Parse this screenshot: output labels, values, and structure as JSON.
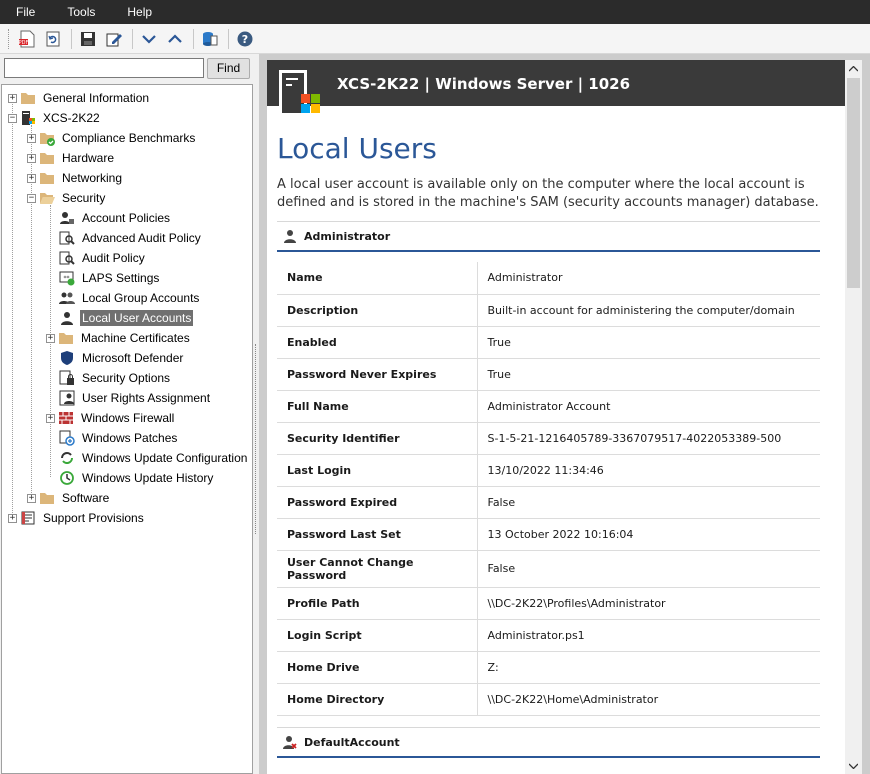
{
  "menu": {
    "file": "File",
    "tools": "Tools",
    "help": "Help"
  },
  "toolbar": {
    "icons": [
      "pdf-export-icon",
      "refresh-icon",
      "save-icon",
      "edit-icon",
      "collapse-down-icon",
      "expand-up-icon",
      "database-icon",
      "help-icon"
    ]
  },
  "search": {
    "value": "",
    "placeholder": "",
    "find_label": "Find"
  },
  "tree": {
    "general_information": "General Information",
    "server": "XCS-2K22",
    "compliance": "Compliance Benchmarks",
    "hardware": "Hardware",
    "networking": "Networking",
    "security": "Security",
    "account_policies": "Account Policies",
    "advanced_audit": "Advanced Audit Policy",
    "audit_policy": "Audit Policy",
    "laps": "LAPS Settings",
    "local_group": "Local Group Accounts",
    "local_user": "Local User Accounts",
    "machine_certs": "Machine Certificates",
    "defender": "Microsoft Defender",
    "security_options": "Security Options",
    "user_rights": "User Rights Assignment",
    "firewall": "Windows Firewall",
    "patches": "Windows Patches",
    "update_config": "Windows Update Configuration",
    "update_history": "Windows Update History",
    "software": "Software",
    "support": "Support Provisions"
  },
  "doc": {
    "header_title": "XCS-2K22 | Windows Server | 1026",
    "heading": "Local Users",
    "intro": "A local user account is available only on the computer where the local account is defined and is stored in the machine's SAM (security accounts manager) database.",
    "section1": "Administrator",
    "section2": "DefaultAccount",
    "rows": [
      {
        "k": "Name",
        "v": "Administrator"
      },
      {
        "k": "Description",
        "v": "Built-in account for administering the computer/domain"
      },
      {
        "k": "Enabled",
        "v": "True"
      },
      {
        "k": "Password Never Expires",
        "v": "True"
      },
      {
        "k": "Full Name",
        "v": "Administrator Account"
      },
      {
        "k": "Security Identifier",
        "v": "S-1-5-21-1216405789-3367079517-4022053389-500"
      },
      {
        "k": "Last Login",
        "v": "13/10/2022 11:34:46"
      },
      {
        "k": "Password Expired",
        "v": "False"
      },
      {
        "k": "Password Last Set",
        "v": "13 October 2022 10:16:04"
      },
      {
        "k": "User Cannot Change Password",
        "v": "False"
      },
      {
        "k": "Profile Path",
        "v": "\\\\DC-2K22\\Profiles\\Administrator"
      },
      {
        "k": "Login Script",
        "v": "Administrator.ps1"
      },
      {
        "k": "Home Drive",
        "v": "Z:"
      },
      {
        "k": "Home Directory",
        "v": "\\\\DC-2K22\\Home\\Administrator"
      }
    ]
  },
  "colors": {
    "accent": "#2b5797",
    "header_bg": "#3a3a3a",
    "menubar_bg": "#2b2b2b",
    "selection": "#707070"
  }
}
